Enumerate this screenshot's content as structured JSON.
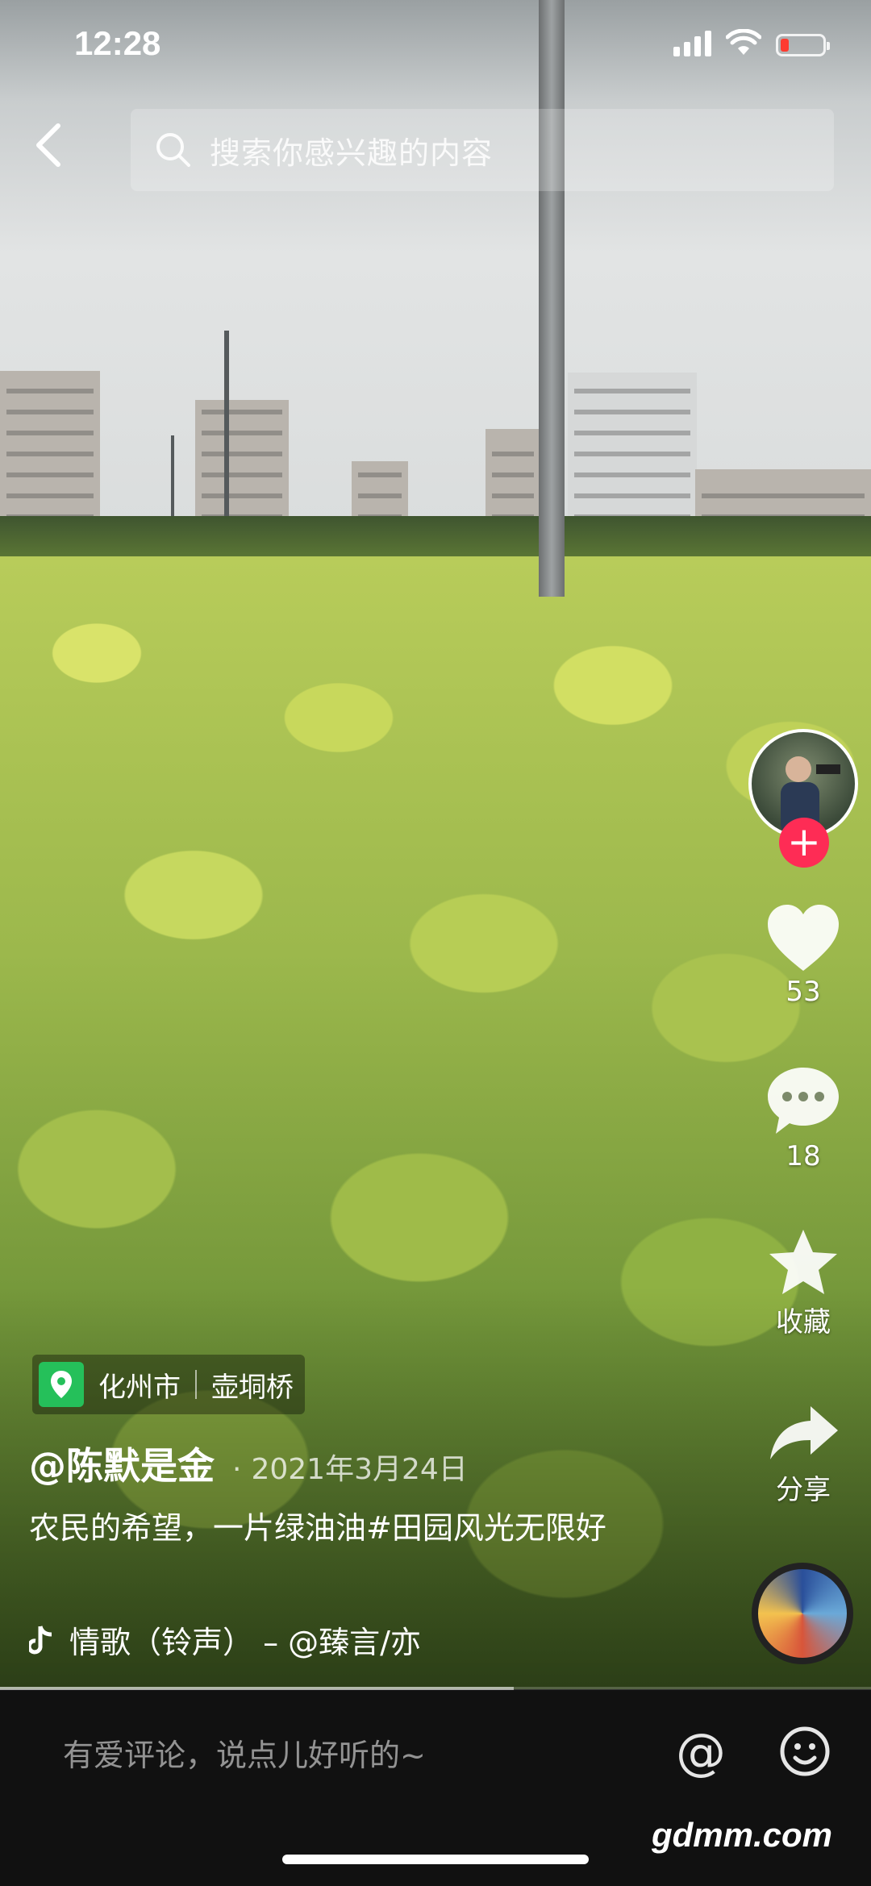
{
  "status_bar": {
    "time": "12:28",
    "battery_level": 0.2
  },
  "search": {
    "placeholder": "搜索你感兴趣的内容"
  },
  "rail": {
    "likes": "53",
    "comments": "18",
    "favorite_label": "收藏",
    "share_label": "分享"
  },
  "post": {
    "location": {
      "city": "化州市",
      "place": "壶垌桥"
    },
    "author": "@陈默是金",
    "date": "2021年3月24日",
    "caption": "农民的希望，一片绿油油#田园风光无限好",
    "music": "情歌（铃声） – @臻言/亦",
    "progress": 0.59
  },
  "comment_bar": {
    "placeholder": "有爱评论，说点儿好听的~",
    "at_symbol": "@"
  },
  "watermark": "gdmm.com",
  "colors": {
    "like_accent": "#fe2c55",
    "location_pin": "#25c05a",
    "battery_low": "#ff3b30"
  }
}
